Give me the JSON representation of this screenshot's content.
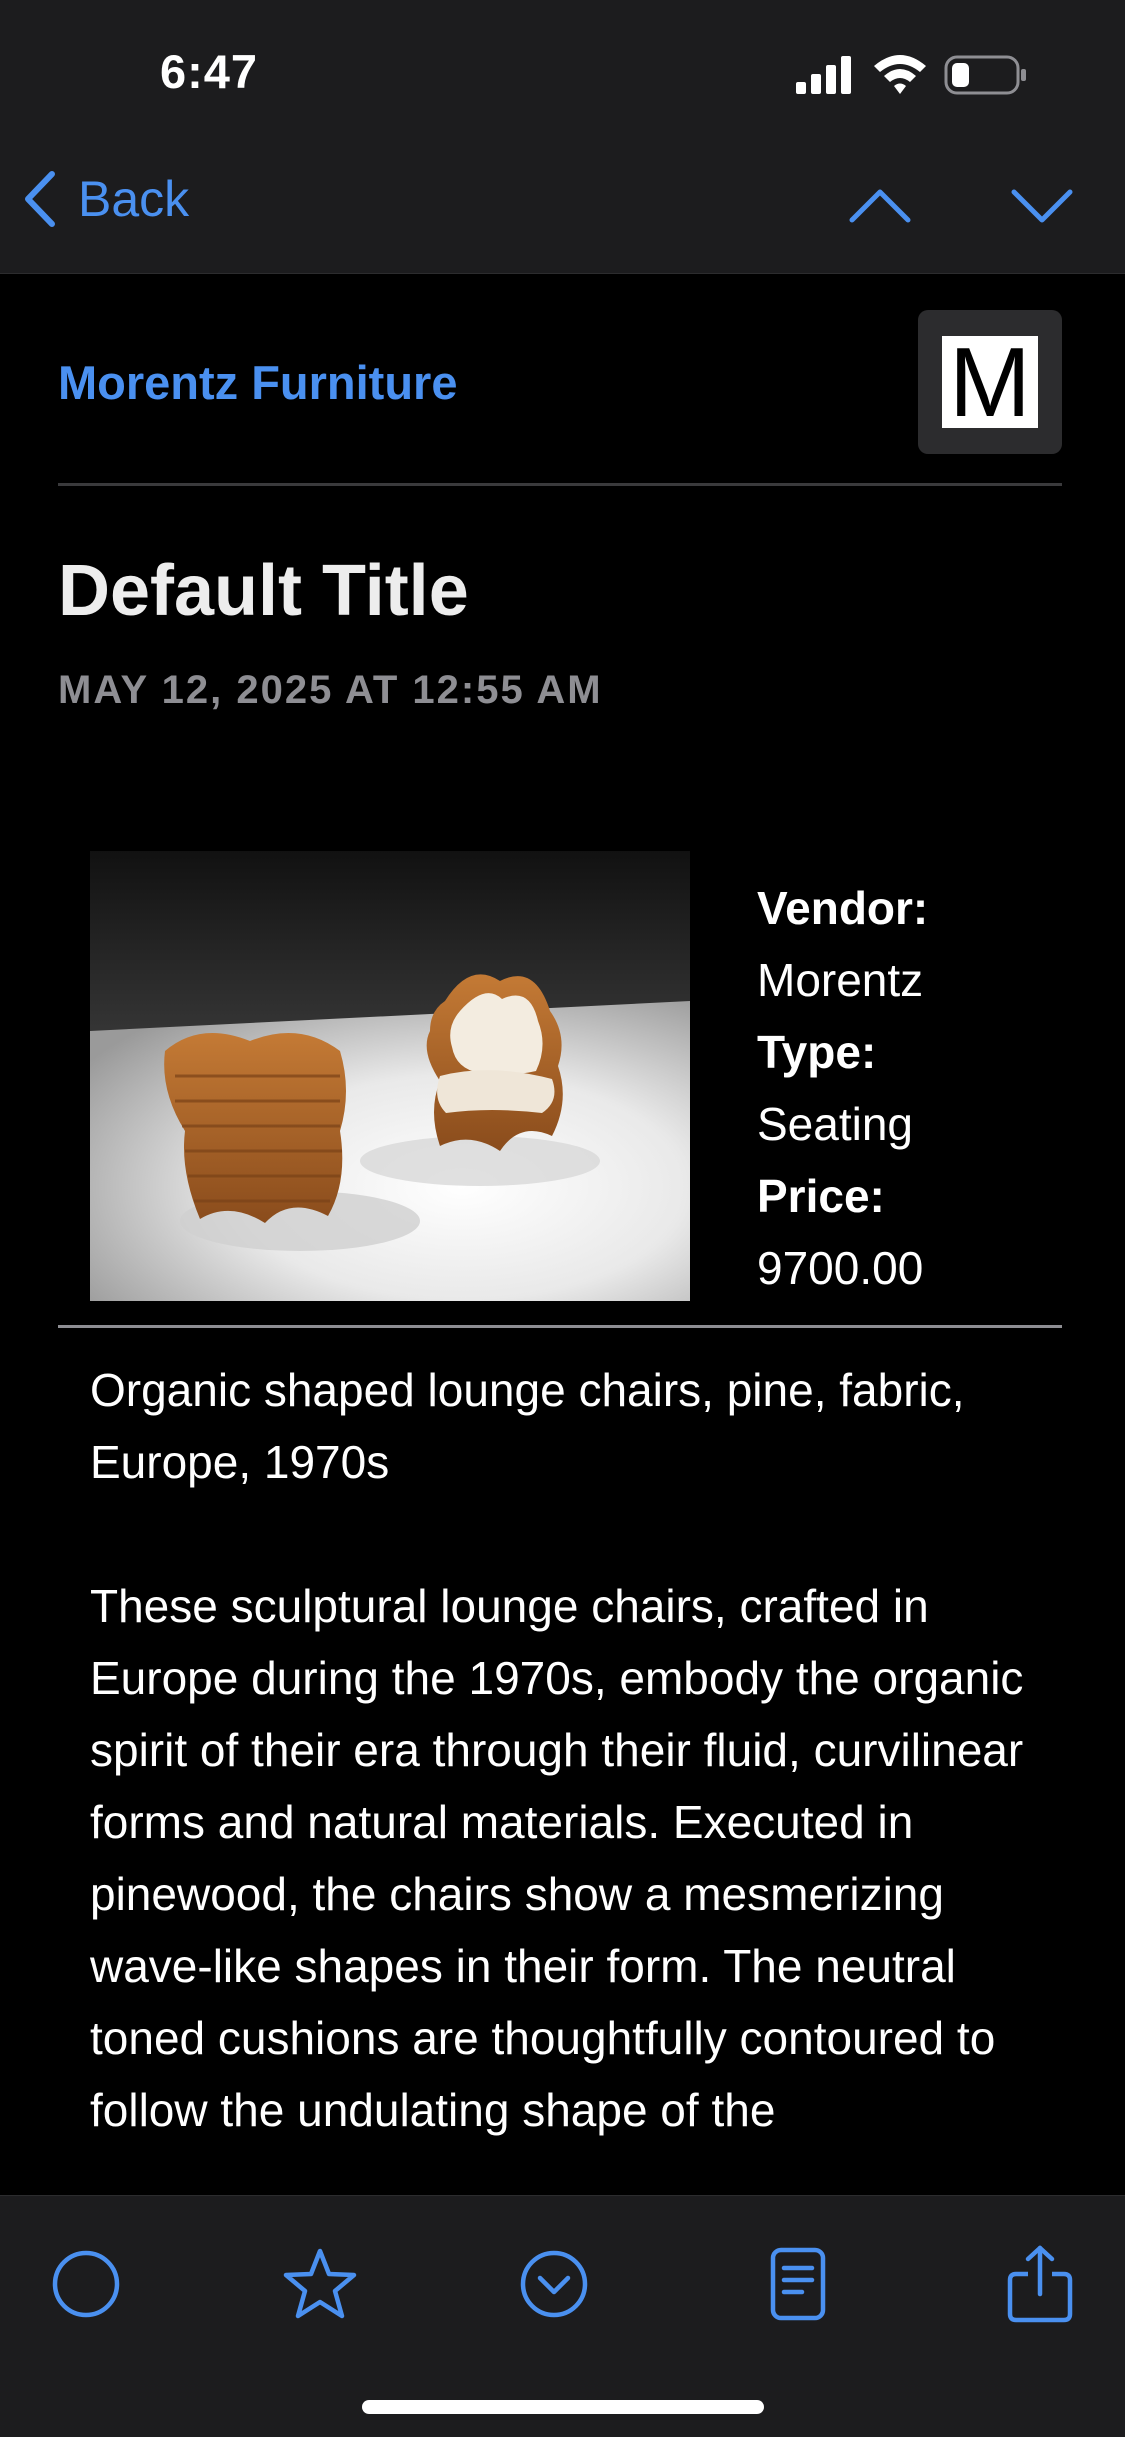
{
  "status_bar": {
    "time": "6:47"
  },
  "nav": {
    "back_label": "Back"
  },
  "email": {
    "sender": "Morentz Furniture",
    "sender_logo_letter": "M",
    "title": "Default Title",
    "date": "MAY 12, 2025 AT 12:55 AM"
  },
  "product": {
    "vendor_label": "Vendor:",
    "vendor": "Morentz",
    "type_label": "Type:",
    "type": "Seating",
    "price_label": "Price:",
    "price": "9700.00"
  },
  "body": {
    "summary": "Organic shaped lounge chairs, pine, fabric, Europe, 1970s",
    "description": "These sculptural lounge chairs, crafted in Europe during the 1970s, embody the organic spirit of their era through their fluid, curvilinear forms and natural materials. Executed in pinewood, the chairs show a mesmerizing wave-like shapes in their form. The neutral toned cushions are thoughtfully contoured to follow the undulating shape of the"
  },
  "toolbar": {
    "icons": [
      "circle-icon",
      "star-icon",
      "chevron-circle-icon",
      "document-icon",
      "share-icon"
    ]
  },
  "colors": {
    "accent": "#4a90f0",
    "background": "#000000",
    "bar": "#1c1c1e"
  }
}
